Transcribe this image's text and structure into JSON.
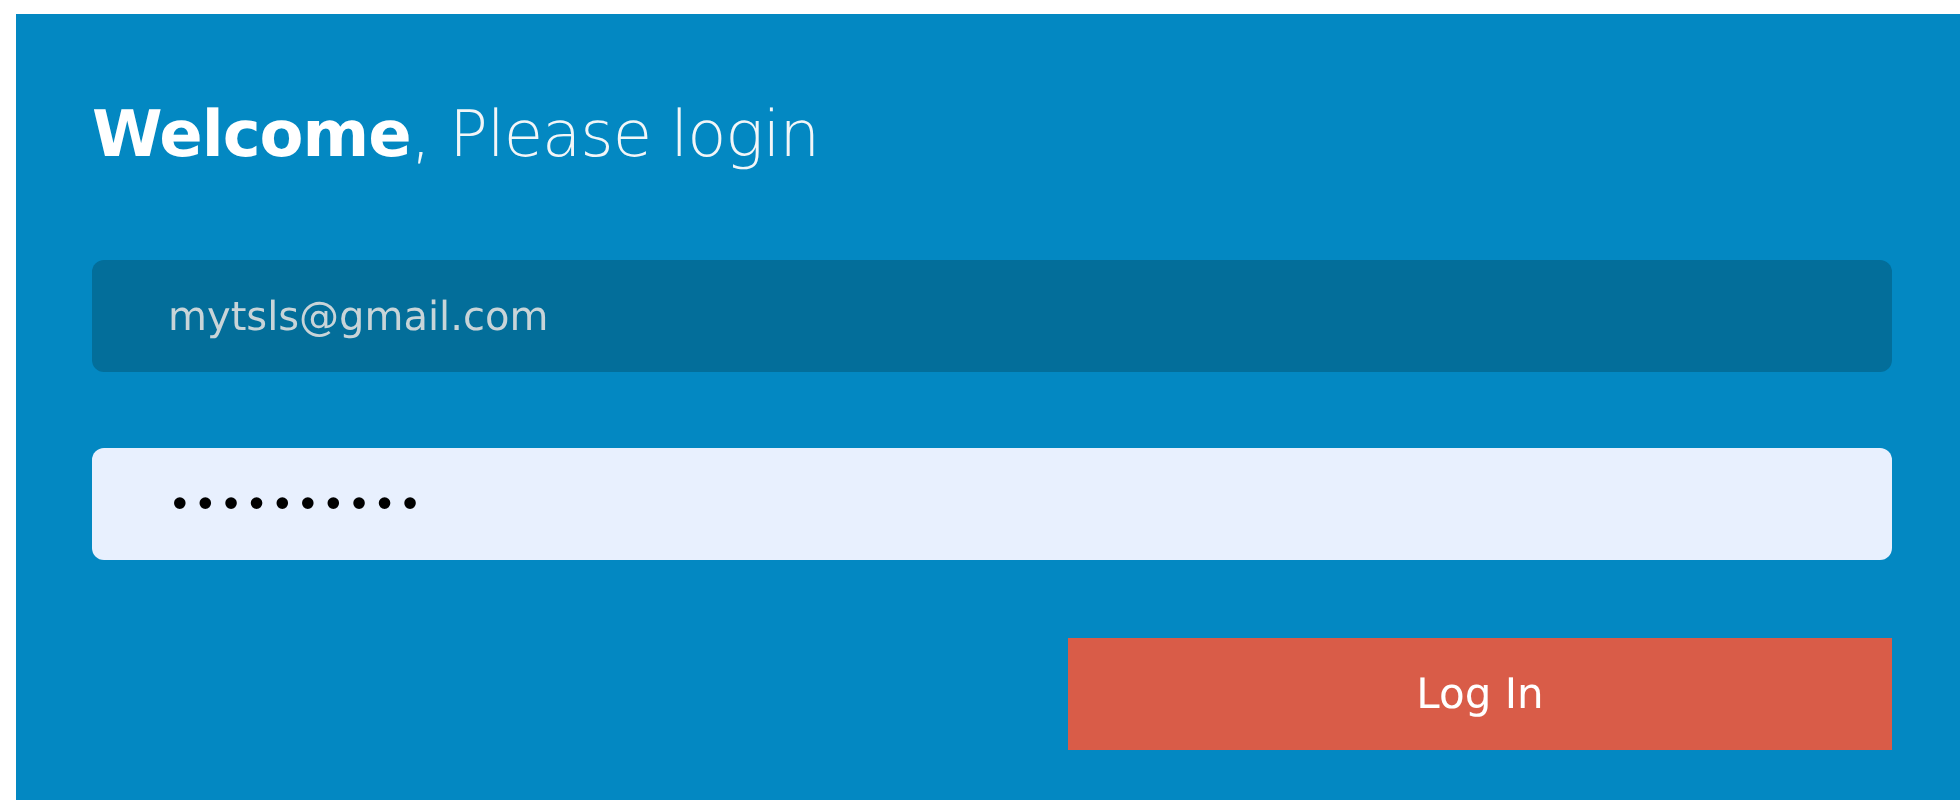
{
  "heading": "**Welcome**, Please login",
  "email_field": {
    "value": "mytsls@gmail.com"
  },
  "password_field": {
    "value": "••••••••••"
  },
  "login_button": {
    "label": "Log In"
  }
}
